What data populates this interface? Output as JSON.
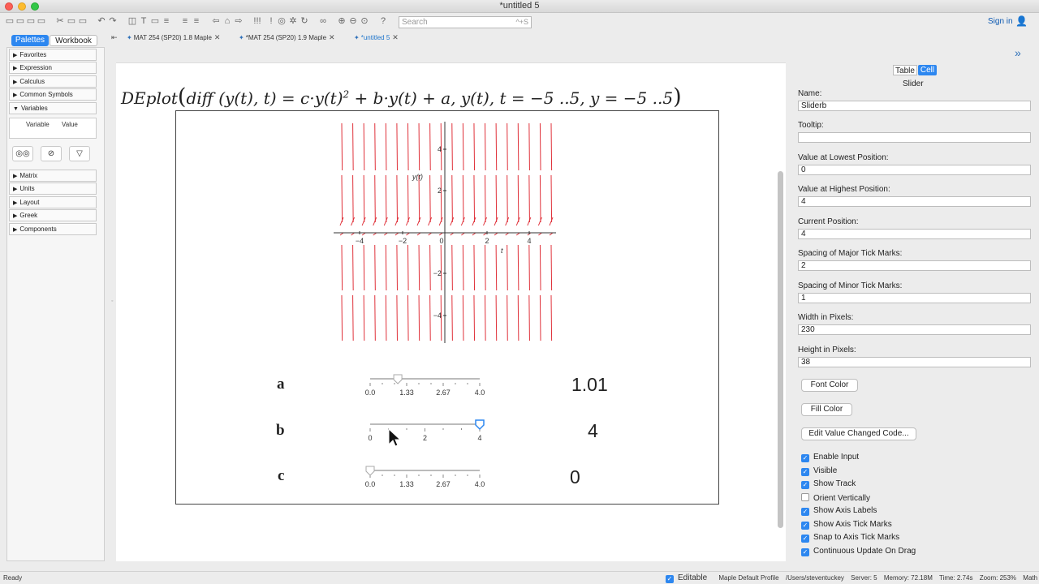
{
  "window": {
    "title": "*untitled 5"
  },
  "toolbar": {
    "search_placeholder": "Search",
    "search_shortcut": "^+S",
    "signin": "Sign in"
  },
  "left_panel": {
    "tabs": [
      "Palettes",
      "Workbook"
    ],
    "palettes_top": [
      "Favorites",
      "Expression",
      "Calculus",
      "Common Symbols",
      "Variables"
    ],
    "variables_columns": [
      "Variable",
      "Value"
    ],
    "palettes_bottom": [
      "Matrix",
      "Units",
      "Layout",
      "Greek",
      "Components"
    ]
  },
  "doc_tabs": [
    "MAT 254 (SP20) 1.8 Maple",
    "*MAT 254 (SP20) 1.9 Maple",
    "*untitled 5"
  ],
  "command": {
    "fn": "DEplot",
    "inner": "diff",
    "y_of_t": "y(t)",
    "t": "t",
    "rhs_a": "= c·y(t)",
    "exp": "2",
    "rhs_b": "+ b·y(t) + a, y(t), t = −5 ..5, y = −5 ..5"
  },
  "plot": {
    "ylabel": "y(t)",
    "xlabel": "t",
    "x_ticks": [
      "−4",
      "−2",
      "0",
      "2",
      "4"
    ],
    "y_ticks": [
      "4",
      "2",
      "−2",
      "−4"
    ]
  },
  "sliders": [
    {
      "label": "a",
      "ticks": [
        "0.0",
        "1.33",
        "2.67",
        "4.0"
      ],
      "min": 0,
      "max": 4,
      "value": 1.01,
      "display": "1.01"
    },
    {
      "label": "b",
      "ticks": [
        "0",
        "2",
        "4"
      ],
      "min": 0,
      "max": 4,
      "value": 4,
      "display": "4"
    },
    {
      "label": "c",
      "ticks": [
        "0.0",
        "1.33",
        "2.67",
        "4.0"
      ],
      "min": 0,
      "max": 4,
      "value": 0,
      "display": "0"
    }
  ],
  "inspector": {
    "tabs": [
      "Table",
      "Cell"
    ],
    "section": "Slider",
    "fields": [
      {
        "label": "Name:",
        "value": "Sliderb"
      },
      {
        "label": "Tooltip:",
        "value": ""
      },
      {
        "label": "Value at Lowest Position:",
        "value": "0"
      },
      {
        "label": "Value at Highest Position:",
        "value": "4"
      },
      {
        "label": "Current Position:",
        "value": "4"
      },
      {
        "label": "Spacing of Major Tick Marks:",
        "value": "2"
      },
      {
        "label": "Spacing of Minor Tick Marks:",
        "value": "1"
      },
      {
        "label": "Width in Pixels:",
        "value": "230"
      },
      {
        "label": "Height in Pixels:",
        "value": "38"
      }
    ],
    "buttons": [
      "Font Color",
      "Fill Color",
      "Edit Value Changed Code..."
    ],
    "checkboxes": [
      {
        "label": "Enable Input",
        "checked": true
      },
      {
        "label": "Visible",
        "checked": true
      },
      {
        "label": "Show Track",
        "checked": true
      },
      {
        "label": "Orient Vertically",
        "checked": false
      },
      {
        "label": "Show Axis Labels",
        "checked": true
      },
      {
        "label": "Show Axis Tick Marks",
        "checked": true
      },
      {
        "label": "Snap to Axis Tick Marks",
        "checked": true
      },
      {
        "label": "Continuous Update On Drag",
        "checked": true
      }
    ]
  },
  "status": {
    "left": "Ready",
    "editable": "Editable",
    "profile": "Maple Default Profile",
    "path": "/Users/steventuckey",
    "server": "Server: 5",
    "memory": "Memory: 72.18M",
    "time": "Time: 2.74s",
    "zoom": "Zoom: 253%",
    "mode": "Math Mode"
  },
  "colors": {
    "accent": "#2d87f0",
    "field_arrow": "#e0313a",
    "slider_handle": "#2d87f0"
  }
}
